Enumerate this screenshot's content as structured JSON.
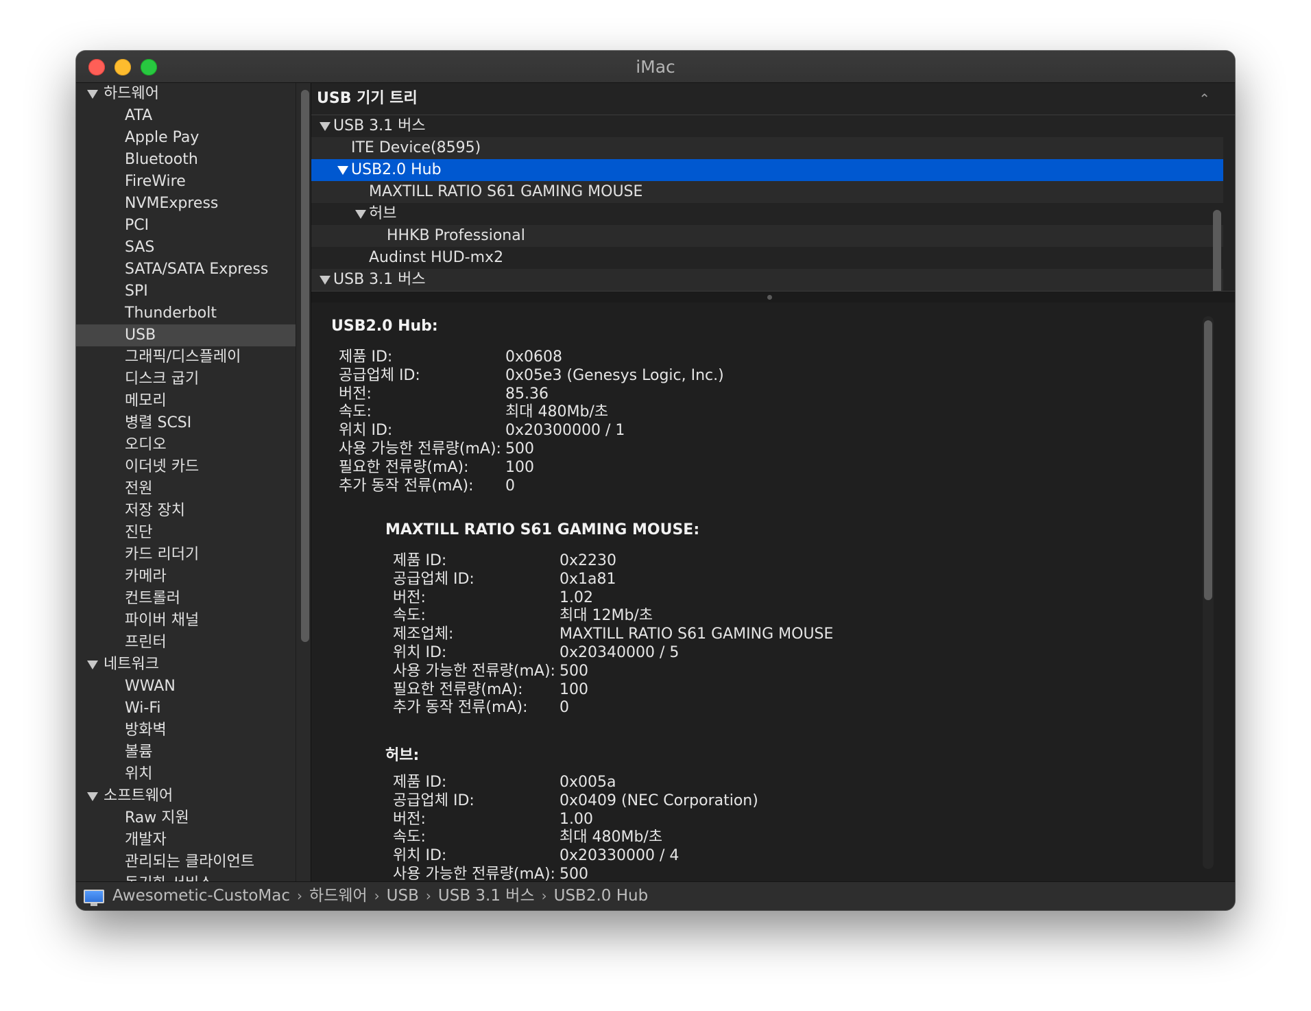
{
  "window": {
    "title": "iMac"
  },
  "sidebar": {
    "groups": [
      {
        "label": "하드웨어",
        "items": [
          "ATA",
          "Apple Pay",
          "Bluetooth",
          "FireWire",
          "NVMExpress",
          "PCI",
          "SAS",
          "SATA/SATA Express",
          "SPI",
          "Thunderbolt",
          "USB",
          "그래픽/디스플레이",
          "디스크 굽기",
          "메모리",
          "병렬 SCSI",
          "오디오",
          "이더넷 카드",
          "전원",
          "저장 장치",
          "진단",
          "카드 리더기",
          "카메라",
          "컨트롤러",
          "파이버 채널",
          "프린터"
        ]
      },
      {
        "label": "네트워크",
        "items": [
          "WWAN",
          "Wi-Fi",
          "방화벽",
          "볼륨",
          "위치"
        ]
      },
      {
        "label": "소프트웨어",
        "items": [
          "Raw 지원",
          "개발자",
          "관리되는 클라이언트",
          "동기화 서비스"
        ]
      }
    ],
    "selected": "USB"
  },
  "tree": {
    "header": "USB 기기 트리",
    "collapse_icon": "chevron-up-icon",
    "rows": [
      {
        "label": "USB 3.1 버스",
        "level": 0,
        "expanded": true
      },
      {
        "label": "ITE Device(8595)",
        "level": 1
      },
      {
        "label": "USB2.0 Hub",
        "level": 1,
        "expanded": true,
        "selected": true
      },
      {
        "label": "MAXTILL RATIO S61 GAMING MOUSE",
        "level": 2
      },
      {
        "label": "허브",
        "level": 2,
        "expanded": true
      },
      {
        "label": "HHKB Professional",
        "level": 3
      },
      {
        "label": "Audinst HUD-mx2",
        "level": 2
      },
      {
        "label": "USB 3.1 버스",
        "level": 0,
        "expanded": true
      }
    ]
  },
  "detail": {
    "title": "USB2.0 Hub:",
    "fields": [
      {
        "k": "제품 ID:",
        "v": "0x0608"
      },
      {
        "k": "공급업체 ID:",
        "v": "0x05e3  (Genesys Logic, Inc.)"
      },
      {
        "k": "버전:",
        "v": "85.36"
      },
      {
        "k": "속도:",
        "v": "최대 480Mb/초"
      },
      {
        "k": "위치 ID:",
        "v": "0x20300000 / 1"
      },
      {
        "k": "사용 가능한 전류량(mA):",
        "v": "500"
      },
      {
        "k": "필요한 전류량(mA):",
        "v": "100"
      },
      {
        "k": "추가 동작 전류(mA):",
        "v": "0"
      }
    ],
    "children": [
      {
        "title": "MAXTILL RATIO S61 GAMING MOUSE:",
        "fields": [
          {
            "k": "제품 ID:",
            "v": "0x2230"
          },
          {
            "k": "공급업체 ID:",
            "v": "0x1a81"
          },
          {
            "k": "버전:",
            "v": "1.02"
          },
          {
            "k": "속도:",
            "v": "최대 12Mb/초"
          },
          {
            "k": "제조업체:",
            "v": "MAXTILL RATIO S61 GAMING MOUSE"
          },
          {
            "k": "위치 ID:",
            "v": "0x20340000 / 5"
          },
          {
            "k": "사용 가능한 전류량(mA):",
            "v": "500"
          },
          {
            "k": "필요한 전류량(mA):",
            "v": "100"
          },
          {
            "k": "추가 동작 전류(mA):",
            "v": "0"
          }
        ]
      },
      {
        "title": "허브:",
        "fields": [
          {
            "k": "제품 ID:",
            "v": "0x005a"
          },
          {
            "k": "공급업체 ID:",
            "v": "0x0409  (NEC Corporation)"
          },
          {
            "k": "버전:",
            "v": "1.00"
          },
          {
            "k": "속도:",
            "v": "최대 480Mb/초"
          },
          {
            "k": "위치 ID:",
            "v": "0x20330000 / 4"
          },
          {
            "k": "사용 가능한 전류량(mA):",
            "v": "500"
          }
        ]
      }
    ]
  },
  "pathbar": {
    "icon": "computer-icon",
    "crumbs": [
      "Awesometic-CustoMac",
      "하드웨어",
      "USB",
      "USB 3.1 버스",
      "USB2.0 Hub"
    ],
    "separator": "›"
  }
}
